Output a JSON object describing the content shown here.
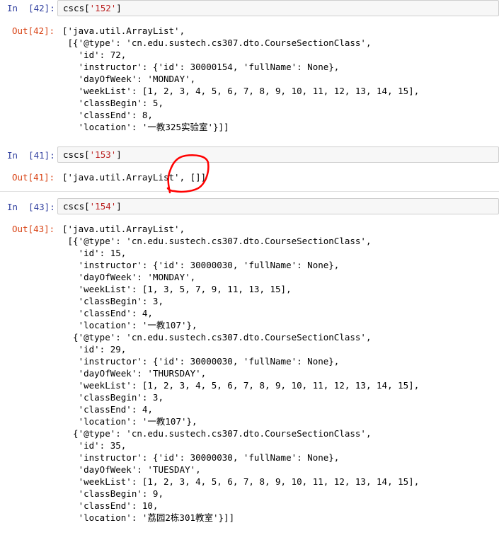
{
  "cells": [
    {
      "in_prompt": "In  [42]:",
      "code_prefix": "cscs[",
      "code_string": "'152'",
      "code_suffix": "]",
      "out_prompt": "Out[42]:",
      "output_lines": [
        "['java.util.ArrayList',",
        " [{'@type': 'cn.edu.sustech.cs307.dto.CourseSectionClass',",
        "   'id': 72,",
        "   'instructor': {'id': 30000154, 'fullName': None},",
        "   'dayOfWeek': 'MONDAY',",
        "   'weekList': [1, 2, 3, 4, 5, 6, 7, 8, 9, 10, 11, 12, 13, 14, 15],",
        "   'classBegin': 5,",
        "   'classEnd': 8,",
        "   'location': '一教325实验室'}]]"
      ]
    },
    {
      "in_prompt": "In  [41]:",
      "code_prefix": "cscs[",
      "code_string": "'153'",
      "code_suffix": "]",
      "out_prompt": "Out[41]:",
      "output_lines": [
        "['java.util.ArrayList', []]"
      ]
    },
    {
      "in_prompt": "In  [43]:",
      "code_prefix": "cscs[",
      "code_string": "'154'",
      "code_suffix": "]",
      "out_prompt": "Out[43]:",
      "output_lines": [
        "['java.util.ArrayList',",
        " [{'@type': 'cn.edu.sustech.cs307.dto.CourseSectionClass',",
        "   'id': 15,",
        "   'instructor': {'id': 30000030, 'fullName': None},",
        "   'dayOfWeek': 'MONDAY',",
        "   'weekList': [1, 3, 5, 7, 9, 11, 13, 15],",
        "   'classBegin': 3,",
        "   'classEnd': 4,",
        "   'location': '一教107'},",
        "  {'@type': 'cn.edu.sustech.cs307.dto.CourseSectionClass',",
        "   'id': 29,",
        "   'instructor': {'id': 30000030, 'fullName': None},",
        "   'dayOfWeek': 'THURSDAY',",
        "   'weekList': [1, 2, 3, 4, 5, 6, 7, 8, 9, 10, 11, 12, 13, 14, 15],",
        "   'classBegin': 3,",
        "   'classEnd': 4,",
        "   'location': '一教107'},",
        "  {'@type': 'cn.edu.sustech.cs307.dto.CourseSectionClass',",
        "   'id': 35,",
        "   'instructor': {'id': 30000030, 'fullName': None},",
        "   'dayOfWeek': 'TUESDAY',",
        "   'weekList': [1, 2, 3, 4, 5, 6, 7, 8, 9, 10, 11, 12, 13, 14, 15],",
        "   'classBegin': 9,",
        "   'classEnd': 10,",
        "   'location': '荔园2栋301教室'}]]"
      ]
    }
  ],
  "colors": {
    "in_prompt": "#303f9f",
    "out_prompt": "#d84315",
    "string": "#ba2121",
    "annotation": "#ff0000"
  }
}
